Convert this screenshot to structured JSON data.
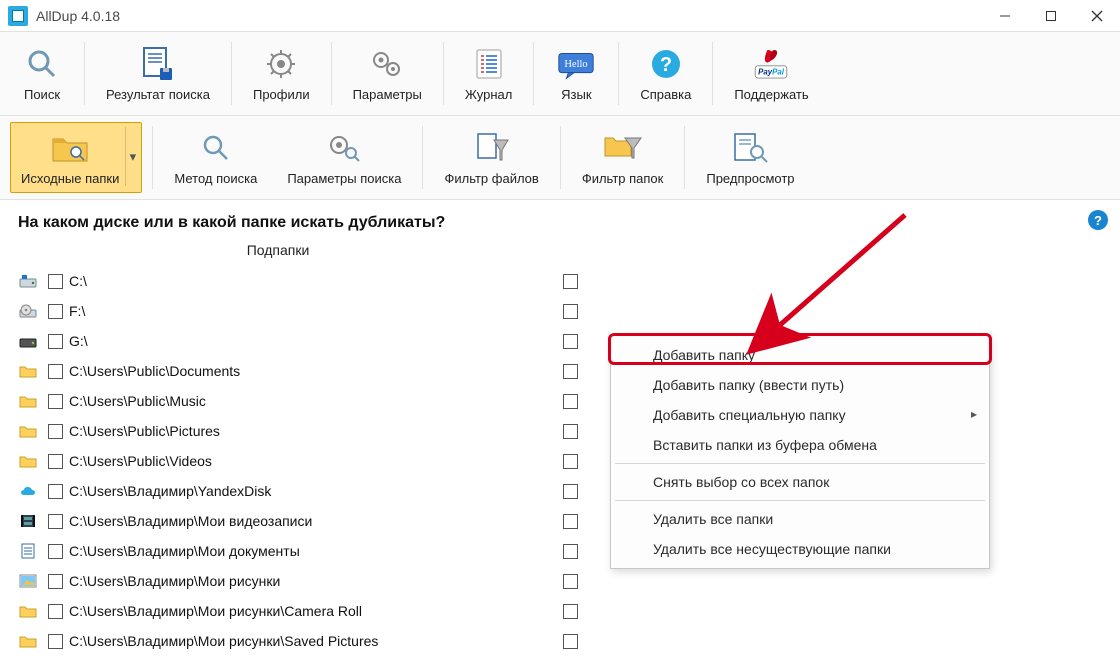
{
  "window": {
    "title": "AllDup 4.0.18"
  },
  "toolbar1": {
    "search": "Поиск",
    "results": "Результат поиска",
    "profiles": "Профили",
    "params": "Параметры",
    "log": "Журнал",
    "language": "Язык",
    "help": "Справка",
    "donate": "Поддержать",
    "hello": "Hello"
  },
  "toolbar2": {
    "source_folders": "Исходные папки",
    "search_method": "Метод поиска",
    "search_params": "Параметры поиска",
    "file_filter": "Фильтр файлов",
    "folder_filter": "Фильтр папок",
    "preview": "Предпросмотр"
  },
  "panel": {
    "heading": "На каком диске или в какой папке искать дубликаты?",
    "subheader": "Подпапки"
  },
  "folders": [
    {
      "icon": "drive-primary",
      "path": "C:\\"
    },
    {
      "icon": "drive-optical",
      "path": "F:\\"
    },
    {
      "icon": "drive-dark",
      "path": "G:\\"
    },
    {
      "icon": "folder",
      "path": "C:\\Users\\Public\\Documents"
    },
    {
      "icon": "folder",
      "path": "C:\\Users\\Public\\Music"
    },
    {
      "icon": "folder",
      "path": "C:\\Users\\Public\\Pictures"
    },
    {
      "icon": "folder",
      "path": "C:\\Users\\Public\\Videos"
    },
    {
      "icon": "cloud",
      "path": "C:\\Users\\Владимир\\YandexDisk"
    },
    {
      "icon": "film",
      "path": "C:\\Users\\Владимир\\Мои видеозаписи"
    },
    {
      "icon": "doc",
      "path": "C:\\Users\\Владимир\\Мои документы"
    },
    {
      "icon": "picture",
      "path": "C:\\Users\\Владимир\\Мои рисунки"
    },
    {
      "icon": "folder",
      "path": "C:\\Users\\Владимир\\Мои рисунки\\Camera Roll"
    },
    {
      "icon": "folder",
      "path": "C:\\Users\\Владимир\\Мои рисунки\\Saved Pictures"
    }
  ],
  "contextmenu": {
    "add_folder": "Добавить папку",
    "add_folder_path": "Добавить папку (ввести путь)",
    "add_special": "Добавить специальную папку",
    "paste_clipboard": "Вставить папки из буфера обмена",
    "deselect_all": "Снять выбор со всех папок",
    "delete_all": "Удалить все папки",
    "delete_nonexisting": "Удалить все несуществующие папки"
  }
}
